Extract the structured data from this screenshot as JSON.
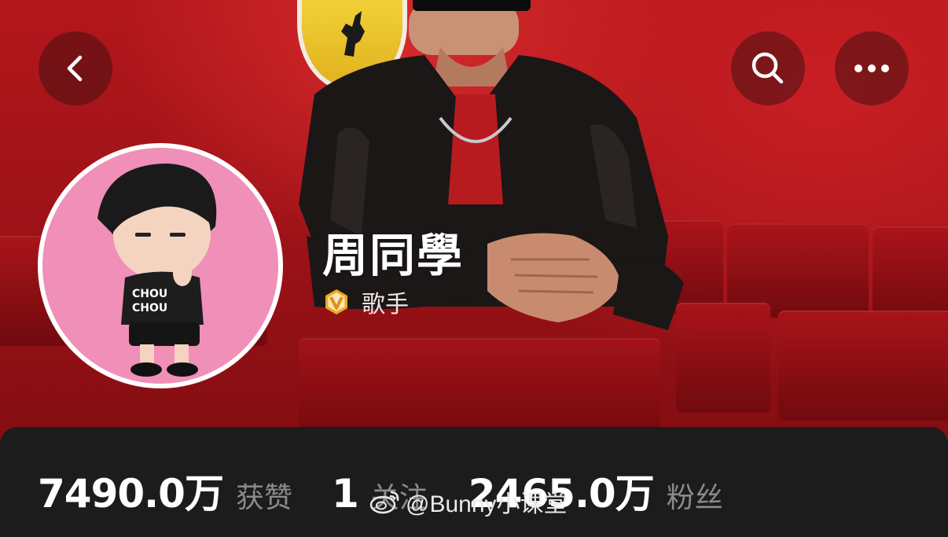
{
  "header": {
    "back_icon": "chevron-left-icon",
    "search_icon": "search-icon",
    "more_icon": "more-horizontal-icon"
  },
  "profile": {
    "name": "周同學",
    "verified_icon": "verified-v-badge-icon",
    "verified_color": "#f0a822",
    "role": "歌手",
    "avatar_text_line1": "CHOU",
    "avatar_text_line2": "CHOU"
  },
  "stats": [
    {
      "value": "7490.0万",
      "label": "获赞"
    },
    {
      "value": "1",
      "label": "关注"
    },
    {
      "value": "2465.0万",
      "label": "粉丝"
    }
  ],
  "watermark": {
    "text": "@Bunny小课堂",
    "icon": "weibo-logo-icon"
  },
  "colors": {
    "hero_red": "#b3171c",
    "panel_dark": "#1c1c1d",
    "avatar_pink": "#f08fb7"
  }
}
